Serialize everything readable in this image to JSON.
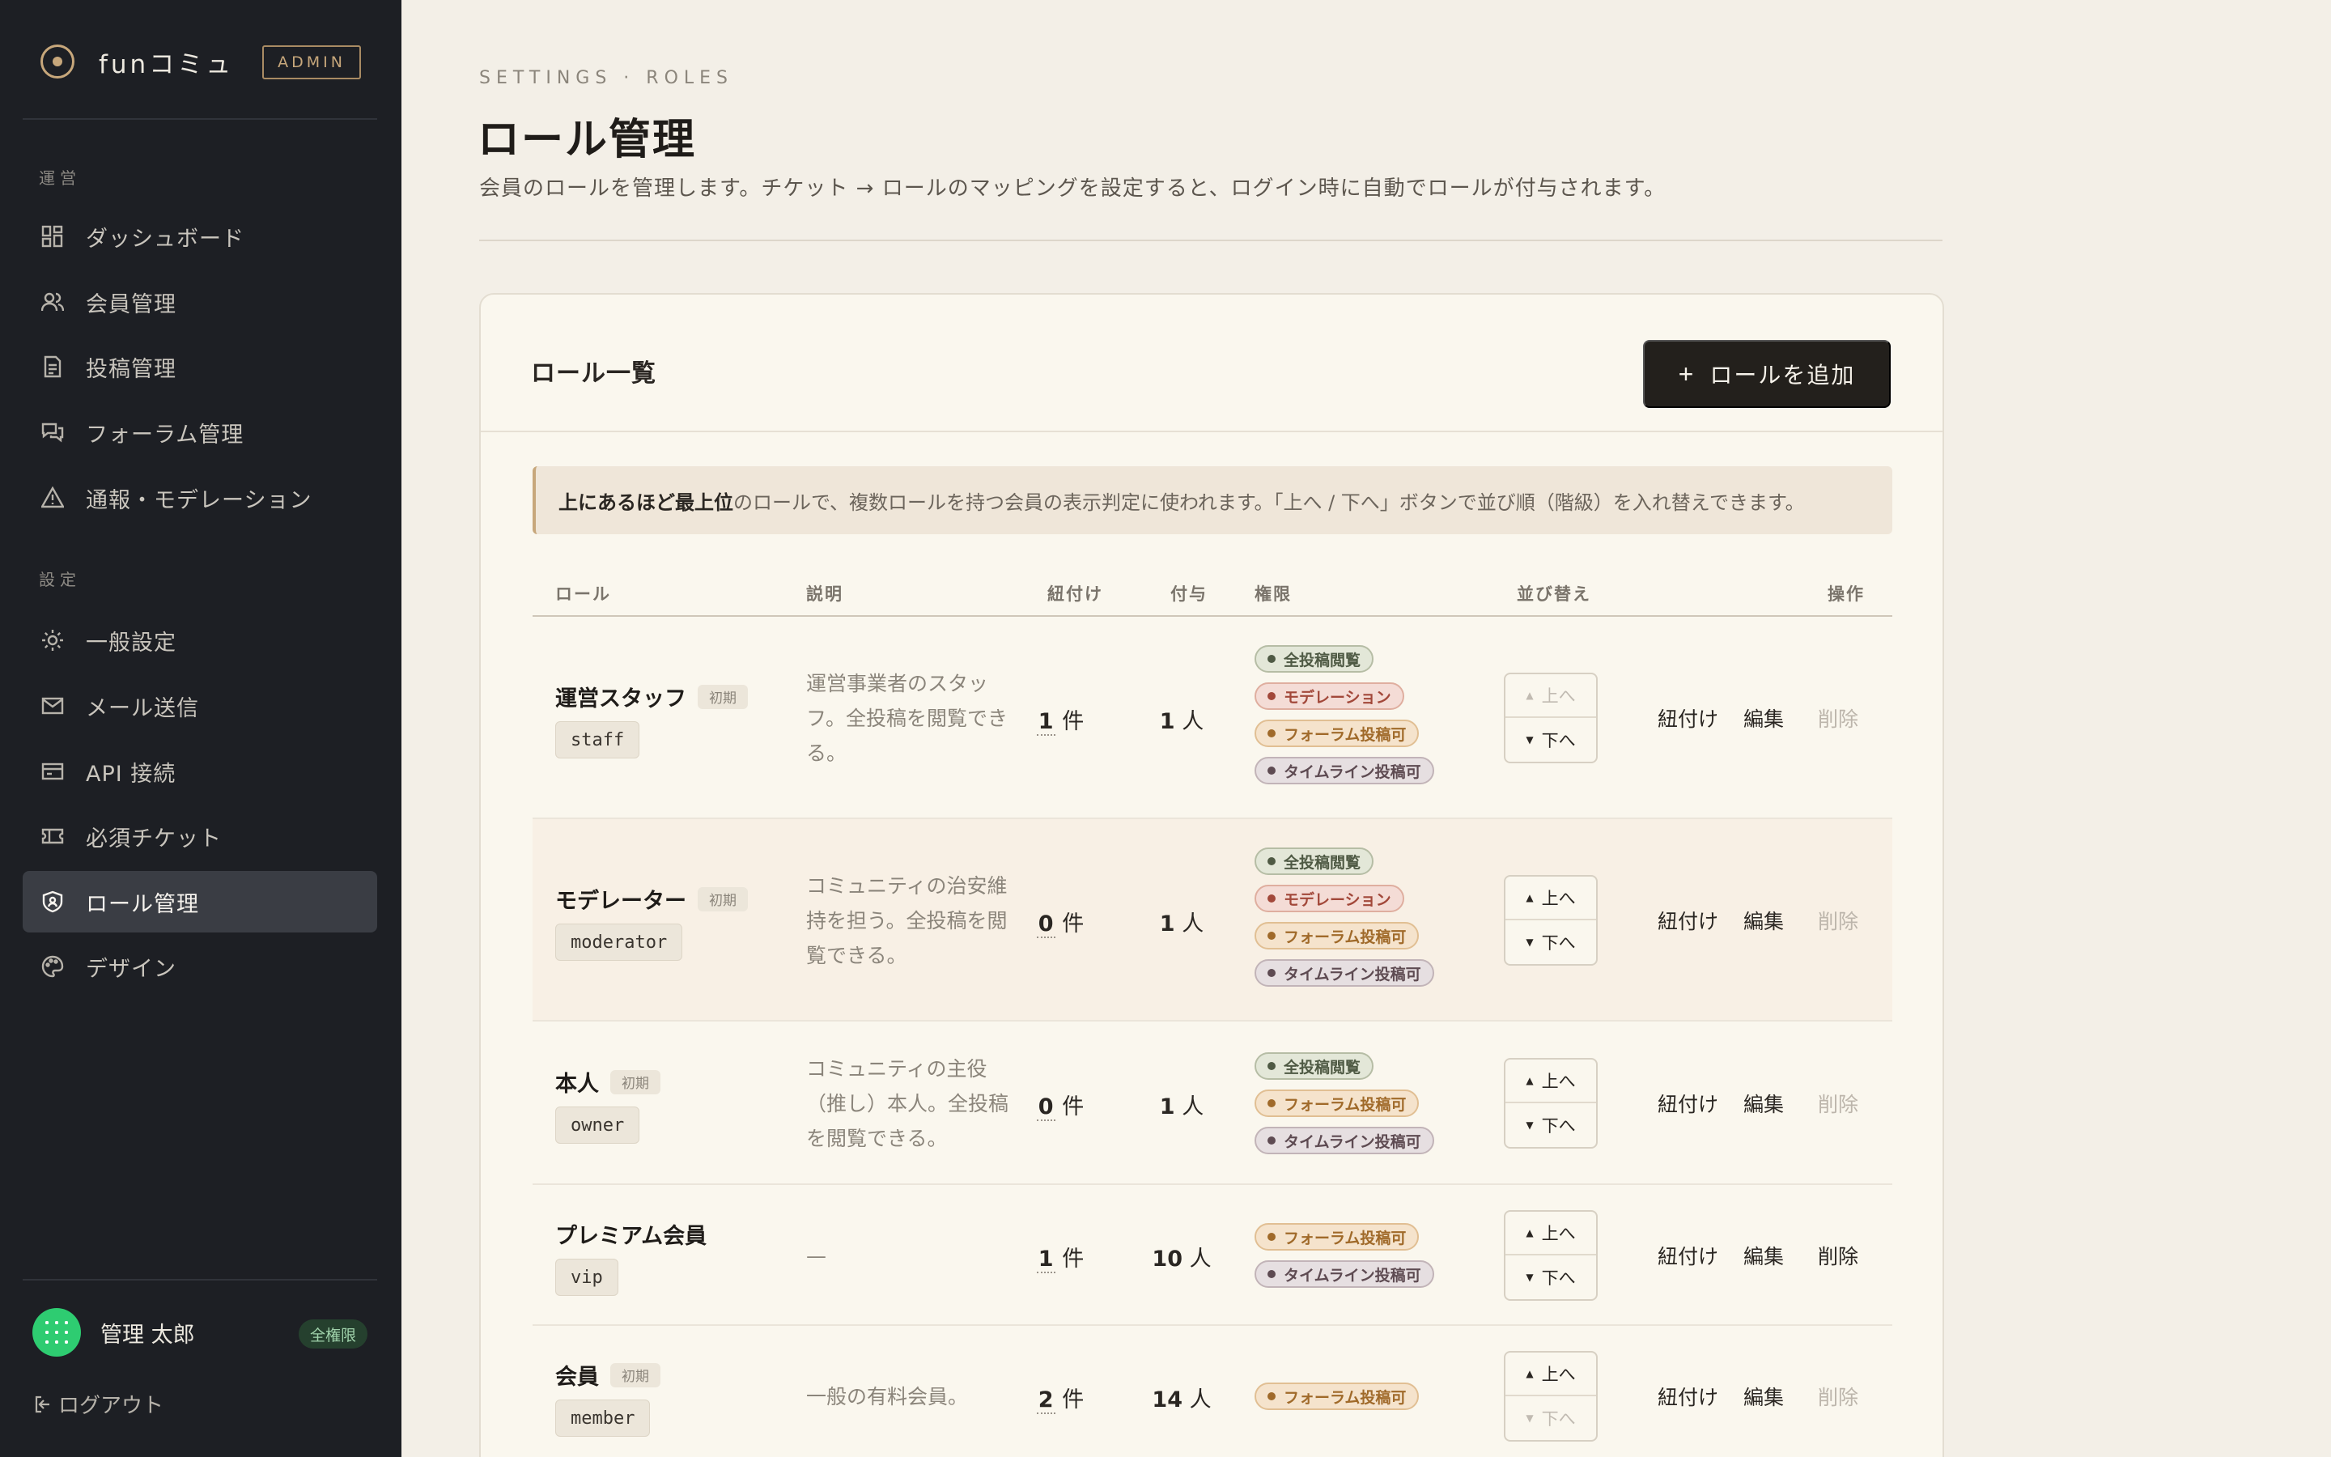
{
  "sidebar": {
    "brand": "funコミュ",
    "badge": "ADMIN",
    "section_ops": "運営",
    "section_settings": "設定",
    "items": [
      {
        "label": "ダッシュボード",
        "icon": "dashboard-icon"
      },
      {
        "label": "会員管理",
        "icon": "users-icon"
      },
      {
        "label": "投稿管理",
        "icon": "document-icon"
      },
      {
        "label": "フォーラム管理",
        "icon": "chat-icon"
      },
      {
        "label": "通報・モデレーション",
        "icon": "warning-icon"
      },
      {
        "label": "一般設定",
        "icon": "gear-icon"
      },
      {
        "label": "メール送信",
        "icon": "mail-icon"
      },
      {
        "label": "API 接続",
        "icon": "api-icon"
      },
      {
        "label": "必須チケット",
        "icon": "ticket-icon"
      },
      {
        "label": "ロール管理",
        "icon": "shield-icon",
        "active": true
      },
      {
        "label": "デザイン",
        "icon": "palette-icon"
      }
    ],
    "user": {
      "name": "管理 太郎",
      "badge": "全権限"
    },
    "logout": "ログアウト"
  },
  "main": {
    "breadcrumb": "SETTINGS · ROLES",
    "title": "ロール管理",
    "description": "会員のロールを管理します。チケット → ロールのマッピングを設定すると、ログイン時に自動でロールが付与されます。",
    "card": {
      "title": "ロール一覧",
      "add_button": "ロールを追加",
      "notice_bold": "上にあるほど最上位",
      "notice_rest": "のロールで、複数ロールを持つ会員の表示判定に使われます。「上へ / 下へ」ボタンで並び順（階級）を入れ替えできます。",
      "columns": {
        "role": "ロール",
        "desc": "説明",
        "links": "紐付け",
        "grants": "付与",
        "perms": "権限",
        "order": "並び替え",
        "actions": "操作"
      },
      "unit_links": "件",
      "unit_people": "人",
      "sort_up": "上へ",
      "sort_down": "下へ",
      "act_link": "紐付け",
      "act_edit": "編集",
      "act_delete": "削除",
      "initial_tag": "初期",
      "perm_labels": {
        "view": "全投稿閲覧",
        "mod": "モデレーション",
        "forum": "フォーラム投稿可",
        "tl": "タイムライン投稿可"
      },
      "rows": [
        {
          "name": "運営スタッフ",
          "key": "staff",
          "initial": true,
          "desc": "運営事業者のスタッフ。全投稿を閲覧できる。",
          "links": "1",
          "people": "1",
          "perms": [
            "view",
            "mod",
            "forum",
            "tl"
          ],
          "up_disabled": true,
          "down_disabled": false,
          "delete_disabled": true
        },
        {
          "name": "モデレーター",
          "key": "moderator",
          "initial": true,
          "desc": "コミュニティの治安維持を担う。全投稿を閲覧できる。",
          "links": "0",
          "people": "1",
          "perms": [
            "view",
            "mod",
            "forum",
            "tl"
          ],
          "up_disabled": false,
          "down_disabled": false,
          "delete_disabled": true
        },
        {
          "name": "本人",
          "key": "owner",
          "initial": true,
          "desc": "コミュニティの主役（推し）本人。全投稿を閲覧できる。",
          "links": "0",
          "people": "1",
          "perms": [
            "view",
            "forum",
            "tl"
          ],
          "up_disabled": false,
          "down_disabled": false,
          "delete_disabled": true
        },
        {
          "name": "プレミアム会員",
          "key": "vip",
          "initial": false,
          "desc": "—",
          "links": "1",
          "people": "10",
          "perms": [
            "forum",
            "tl"
          ],
          "up_disabled": false,
          "down_disabled": false,
          "delete_disabled": false
        },
        {
          "name": "会員",
          "key": "member",
          "initial": true,
          "desc": "一般の有料会員。",
          "links": "2",
          "people": "14",
          "perms": [
            "forum"
          ],
          "up_disabled": false,
          "down_disabled": true,
          "delete_disabled": true
        }
      ]
    }
  }
}
